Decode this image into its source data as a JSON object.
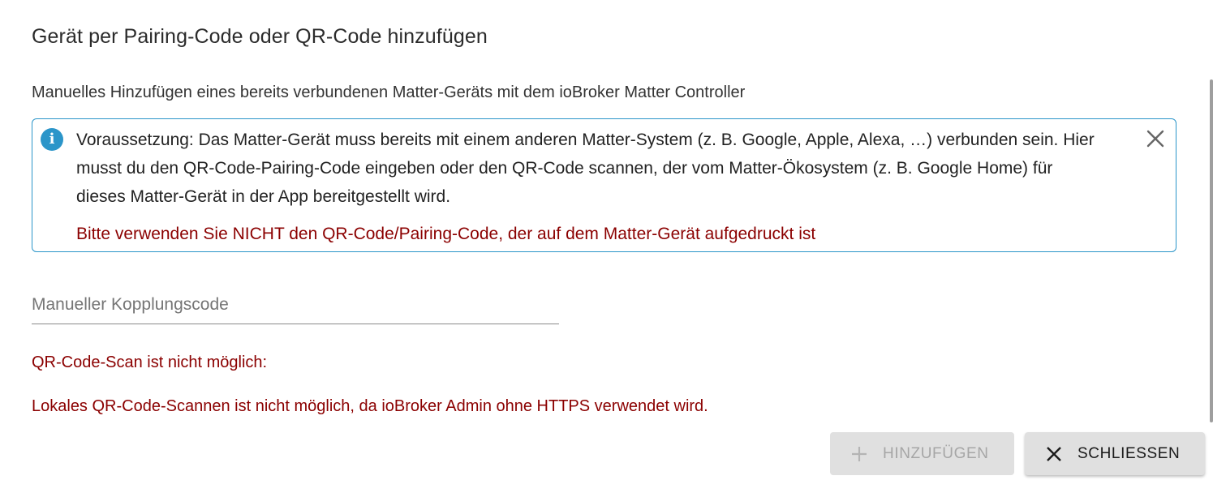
{
  "dialog": {
    "title": "Gerät per Pairing-Code oder QR-Code hinzufügen",
    "subtitle": "Manuelles Hinzufügen eines bereits verbundenen Matter-Geräts mit dem ioBroker Matter Controller"
  },
  "alert": {
    "text": "Voraussetzung: Das Matter-Gerät muss bereits mit einem anderen Matter-System (z. B. Google, Apple, Alexa, …) verbunden sein. Hier musst du den QR-Code-Pairing-Code eingeben oder den QR-Code scannen, der vom Matter-Ökosystem (z. B. Google Home) für dieses Matter-Gerät in der App bereitgestellt wird.",
    "warning": "Bitte verwenden Sie NICHT den QR-Code/Pairing-Code, der auf dem Matter-Gerät aufgedruckt ist",
    "icon": "info-icon",
    "close_icon": "close-icon",
    "color": "#2b95c9"
  },
  "pairing_field": {
    "placeholder": "Manueller Kopplungscode",
    "value": ""
  },
  "errors": {
    "qr_title": "QR-Code-Scan ist nicht möglich:",
    "qr_reason": "Lokales QR-Code-Scannen ist nicht möglich, da ioBroker Admin ohne HTTPS verwendet wird.",
    "color": "#8b0000"
  },
  "actions": {
    "add_label": "HINZUFÜGEN",
    "add_icon": "plus-icon",
    "close_label": "SCHLIESSEN",
    "close_icon": "close-icon"
  }
}
